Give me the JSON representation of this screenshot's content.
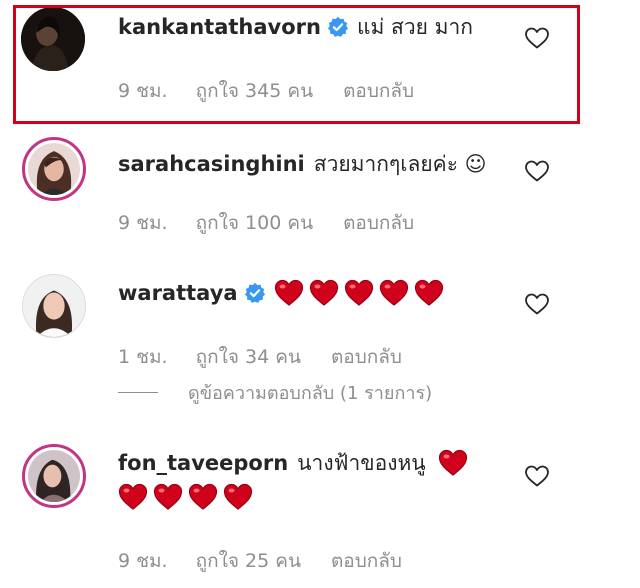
{
  "comments": [
    {
      "username": "kankantathavorn",
      "verified": true,
      "text": "แม่ สวย มาก",
      "time": "9 ชม.",
      "likes": "ถูกใจ 345 คน",
      "reply": "ตอบกลับ"
    },
    {
      "username": "sarahcasinghini",
      "verified": false,
      "text": "สวยมากๆเลยค่ะ ☺",
      "time": "9 ชม.",
      "likes": "ถูกใจ 100 คน",
      "reply": "ตอบกลับ"
    },
    {
      "username": "warattaya",
      "verified": true,
      "text": "",
      "hearts": 5,
      "time": "1 ชม.",
      "likes": "ถูกใจ 34 คน",
      "reply": "ตอบกลับ",
      "view_replies": "ดูข้อความตอบกลับ (1 รายการ)"
    },
    {
      "username": "fon_taveeporn",
      "verified": false,
      "text": "นางฟ้าของหนู",
      "hearts": 5,
      "time": "9 ชม.",
      "likes": "ถูกใจ 25 คน",
      "reply": "ตอบกลับ"
    }
  ],
  "colors": {
    "highlight_border": "#d3001a",
    "verified_badge": "#3897f0",
    "heart_red": "#d0021b",
    "meta_gray": "#8e8e8e",
    "story_ring": "#c13584"
  },
  "icons": {
    "like": "heart-outline-icon",
    "verified": "verified-badge-icon",
    "emoji": "red-heart-emoji"
  }
}
